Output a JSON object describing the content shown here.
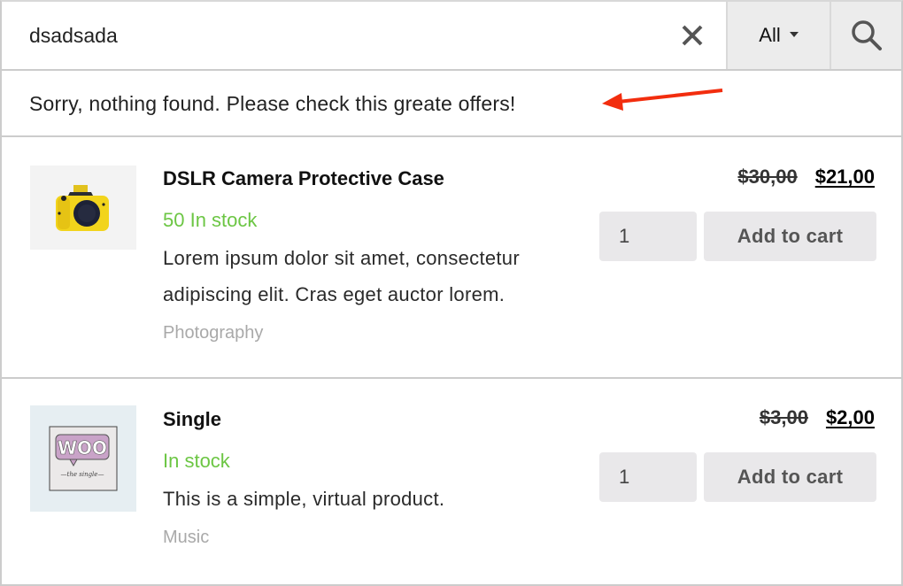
{
  "search": {
    "value": "dsadsada",
    "clear_icon": "close-icon",
    "category": "All",
    "category_icon": "caret-down-icon",
    "search_icon": "search-icon"
  },
  "message": {
    "text": "Sorry, nothing found. Please check this greate offers!",
    "annotation_icon": "red-arrow-left-icon",
    "annotation_color": "#f22d0e"
  },
  "colors": {
    "stock": "#6cc644",
    "button_bg": "#e9e8ea",
    "category_text": "#a9a9a9",
    "border": "#cccccc"
  },
  "products": [
    {
      "title": "DSLR Camera Protective Case",
      "stock": "50 In stock",
      "description": "Lorem ipsum dolor sit amet, consectetur adipiscing elit. Cras eget auctor lorem.",
      "category": "Photography",
      "old_price": "$30,00",
      "new_price": "$21,00",
      "quantity": "1",
      "add_to_cart": "Add to cart",
      "image": "yellow-camera-image"
    },
    {
      "title": "Single",
      "stock": "In stock",
      "description": "This is a simple, virtual product.",
      "category": "Music",
      "old_price": "$3,00",
      "new_price": "$2,00",
      "quantity": "1",
      "add_to_cart": "Add to cart",
      "image": "woo-single-album-image"
    }
  ]
}
